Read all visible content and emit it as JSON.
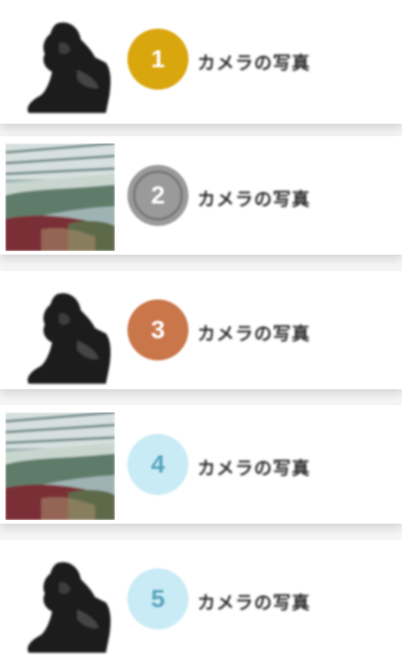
{
  "ranking": {
    "items": [
      {
        "rank": "1",
        "title": "カメラの写真",
        "badge_color": "#d9a60e",
        "thumb_icon": "gorilla-silhouette-icon"
      },
      {
        "rank": "2",
        "title": "カメラの写真",
        "badge_color": "#9a9a9a",
        "thumb_icon": "greenhouse-photo"
      },
      {
        "rank": "3",
        "title": "カメラの写真",
        "badge_color": "#c9774a",
        "thumb_icon": "gorilla-silhouette-icon"
      },
      {
        "rank": "4",
        "title": "カメラの写真",
        "badge_color": "#c8ebf5",
        "thumb_icon": "greenhouse-photo"
      },
      {
        "rank": "5",
        "title": "カメラの写真",
        "badge_color": "#c8ebf5",
        "thumb_icon": "gorilla-silhouette-icon"
      }
    ]
  }
}
